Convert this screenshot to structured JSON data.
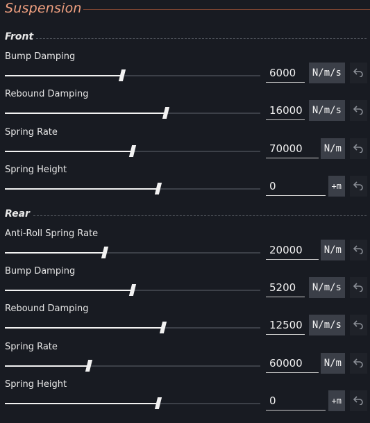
{
  "header": {
    "title": "Suspension"
  },
  "sections": [
    {
      "title": "Front",
      "rows": [
        {
          "label": "Bump Damping",
          "value": "6000",
          "unit": "N/m/s",
          "level": 0.46
        },
        {
          "label": "Rebound Damping",
          "value": "16000",
          "unit": "N/m/s",
          "level": 0.63
        },
        {
          "label": "Spring Rate",
          "value": "70000",
          "unit": "N/m",
          "level": 0.5
        },
        {
          "label": "Spring Height",
          "value": "0",
          "unit": "+m",
          "level": 0.6
        }
      ]
    },
    {
      "title": "Rear",
      "rows": [
        {
          "label": "Anti-Roll Spring Rate",
          "value": "20000",
          "unit": "N/m",
          "level": 0.39
        },
        {
          "label": "Bump Damping",
          "value": "5200",
          "unit": "N/m/s",
          "level": 0.5
        },
        {
          "label": "Rebound Damping",
          "value": "12500",
          "unit": "N/m/s",
          "level": 0.62
        },
        {
          "label": "Spring Rate",
          "value": "60000",
          "unit": "N/m",
          "level": 0.33
        },
        {
          "label": "Spring Height",
          "value": "0",
          "unit": "+m",
          "level": 0.6
        }
      ]
    }
  ],
  "colors": {
    "accent": "#f0a080",
    "background": "#181b22",
    "unit_bg": "#3b3f48"
  },
  "icons": {
    "reset": "undo-arrow-icon"
  }
}
